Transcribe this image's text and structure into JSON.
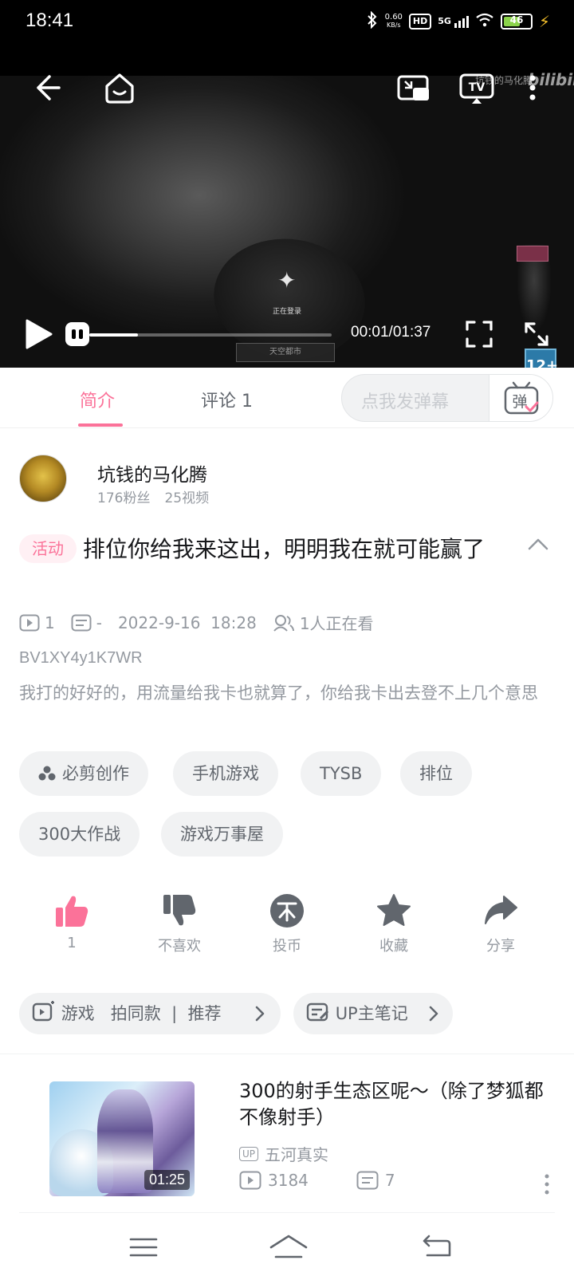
{
  "status_bar": {
    "time": "18:41",
    "net_speed_value": "0.60",
    "net_speed_unit": "KB/s",
    "hd": "HD",
    "network": "5G",
    "battery": "46"
  },
  "video": {
    "watermark": "坑钱的马化腾",
    "logo": "bilibili",
    "loading_text": "正在登录",
    "server_label": "天空都市",
    "age_rating": "12+",
    "time_display": "00:01/01:37",
    "progress": 0.2
  },
  "tabs": {
    "intro": "简介",
    "comments": "评论 1",
    "danmaku_placeholder": "点我发弹幕",
    "danmaku_button": "弹"
  },
  "uploader": {
    "name": "坑钱的马化腾",
    "fans": "176粉丝",
    "videos": "25视频"
  },
  "video_info": {
    "badge": "活动",
    "title": "排位你给我来这出，明明我在就可能赢了",
    "plays": "1",
    "danmaku": "-",
    "date": "2022-9-16  18:28",
    "watching": "1人正在看",
    "bvid": "BV1XY4y1K7WR",
    "description": "我打的好好的，用流量给我卡也就算了，你给我卡出去登不上几个意思"
  },
  "tags": [
    "必剪创作",
    "手机游戏",
    "TYSB",
    "排位",
    "300大作战",
    "游戏万事屋"
  ],
  "actions": {
    "like": "1",
    "dislike": "不喜欢",
    "coin": "投币",
    "favorite": "收藏",
    "share": "分享"
  },
  "chips": {
    "game": "游戏   拍同款  |  推荐",
    "notes": "UP主笔记"
  },
  "related": {
    "title": "300的射手生态区呢～（除了梦狐都不像射手）",
    "duration": "01:25",
    "up_badge": "UP",
    "uploader": "五河真实",
    "plays": "3184",
    "danmaku": "7"
  },
  "colors": {
    "accent": "#fb7299",
    "text_secondary": "#9499a0"
  }
}
